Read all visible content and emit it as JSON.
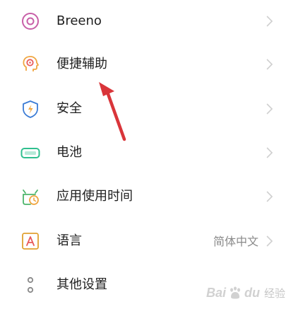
{
  "settings": {
    "items": [
      {
        "label": "Breeno",
        "icon": "breeno-icon",
        "icon_color": "#c85fa8",
        "value": ""
      },
      {
        "label": "便捷辅助",
        "icon": "assistive-head-icon",
        "icon_color": "#f0a640",
        "value": ""
      },
      {
        "label": "安全",
        "icon": "security-shield-icon",
        "icon_color": "#3a7bd5",
        "value": ""
      },
      {
        "label": "电池",
        "icon": "battery-icon",
        "icon_color": "#2fbf8f",
        "value": ""
      },
      {
        "label": "应用使用时间",
        "icon": "app-timer-icon",
        "icon_color": "#4cb56b",
        "value": ""
      },
      {
        "label": "语言",
        "icon": "language-icon",
        "icon_color": "#e0a030",
        "value": "简体中文"
      },
      {
        "label": "其他设置",
        "icon": "more-settings-icon",
        "icon_color": "#888888",
        "value": ""
      }
    ]
  },
  "annotation": {
    "arrow_color": "#d9353a"
  },
  "watermark": {
    "brand": "Bai",
    "brand_tail": "du",
    "sub": "经验"
  }
}
